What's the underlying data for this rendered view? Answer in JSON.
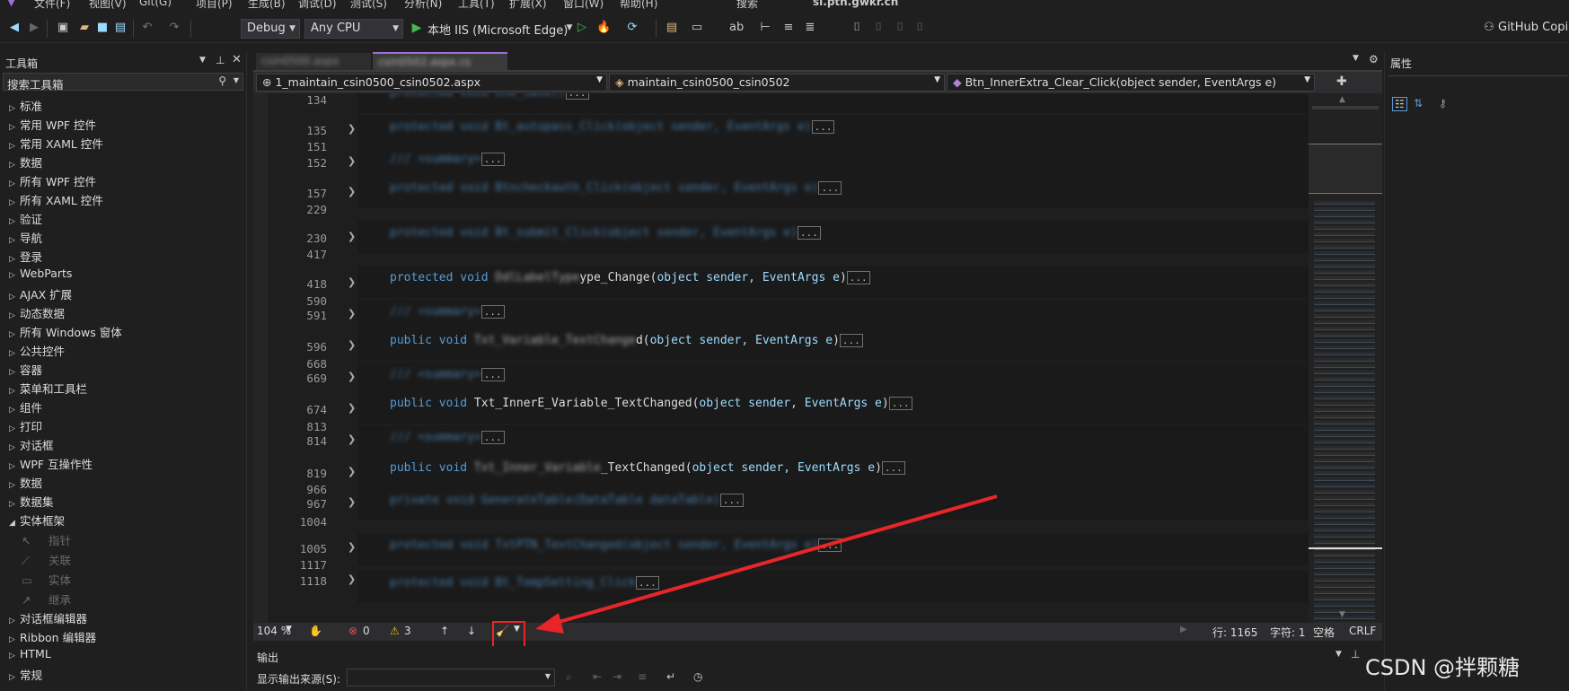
{
  "menu": [
    "文件(F)",
    "视图(V)",
    "Git(G)",
    "项目(P)",
    "生成(B)",
    "调试(D)",
    "测试(S)",
    "分析(N)",
    "工具(T)",
    "扩展(X)",
    "窗口(W)",
    "帮助(H)",
    "搜索",
    "sl.ptn.gwkr.cn"
  ],
  "toolbar": {
    "config": "Debug",
    "platform": "Any CPU",
    "run_target": "本地 IIS (Microsoft Edge)",
    "copilot": "GitHub Copilot"
  },
  "toolbox": {
    "title": "工具箱",
    "search_placeholder": "搜索工具箱",
    "items": [
      "标准",
      "常用 WPF 控件",
      "常用 XAML 控件",
      "数据",
      "所有 WPF 控件",
      "所有 XAML 控件",
      "验证",
      "导航",
      "登录",
      "WebParts",
      "AJAX 扩展",
      "动态数据",
      "所有 Windows 窗体",
      "公共控件",
      "容器",
      "菜单和工具栏",
      "组件",
      "打印",
      "对话框",
      "WPF 互操作性",
      "数据",
      "数据集",
      "实体框架"
    ],
    "sub_items": [
      "指针",
      "关联",
      "实体",
      "继承"
    ],
    "items_after": [
      "对话框编辑器",
      "Ribbon 编辑器",
      "HTML",
      "常规"
    ]
  },
  "editor": {
    "tabs": [
      "csin0500.aspx",
      "csin0502.aspx.cs"
    ],
    "nav": {
      "file": "1_maintain_csin0500_csin0502.aspx",
      "class": "maintain_csin0500_csin0502",
      "member": "Btn_InnerExtra_Clear_Click(object sender, EventArgs e)"
    },
    "lines": [
      {
        "num": "134",
        "text": "protected void Lnk_Save()"
      },
      {
        "num": "135",
        "text": "protected void Bt_autopass_Click(object sender, EventArgs e)"
      },
      {
        "num": "151",
        "text": ""
      },
      {
        "num": "152",
        "text": "/// <summary>"
      },
      {
        "num": "157",
        "text": "protected void Btncheckauth_Click(object sender, EventArgs e)"
      },
      {
        "num": "229",
        "text": ""
      },
      {
        "num": "230",
        "text": "protected void Bt_submit_Click(object sender, EventArgs e)"
      },
      {
        "num": "417",
        "text": ""
      },
      {
        "num": "418",
        "kw": "protected void ",
        "name_blur": "DdlLabelType",
        "name": "ype_Change",
        "params": "object sender, EventArgs e"
      },
      {
        "num": "590",
        "text": ""
      },
      {
        "num": "591",
        "text": "/// <summary>"
      },
      {
        "num": "596",
        "kw": "public void ",
        "name_blur": "Txt_Variable_TextChange",
        "name": "d",
        "params": "object sender, EventArgs e"
      },
      {
        "num": "668",
        "text": ""
      },
      {
        "num": "669",
        "text": "/// <summary>"
      },
      {
        "num": "674",
        "kw": "public void ",
        "name_blur": "",
        "name": "Txt_InnerE_Variable_TextChanged",
        "params": "object sender, EventArgs e"
      },
      {
        "num": "813",
        "text": ""
      },
      {
        "num": "814",
        "text": "/// <summary>"
      },
      {
        "num": "819",
        "kw": "public void ",
        "name_blur": "Txt_Inner_Variable",
        "name": "_TextChanged",
        "params": "object sender, EventArgs e"
      },
      {
        "num": "966",
        "text": ""
      },
      {
        "num": "967",
        "text": "private void GenerateTable(DataTable dataTable)"
      },
      {
        "num": "1004",
        "text": ""
      },
      {
        "num": "1005",
        "text": "protected void TxtPTN_TextChanged(object sender, EventArgs e)"
      },
      {
        "num": "1117",
        "text": ""
      },
      {
        "num": "1118",
        "text": "protected void Bt_TempSetting_Click"
      }
    ]
  },
  "status": {
    "zoom": "104 %",
    "errors": "0",
    "warnings": "3",
    "line": "行: 1165",
    "char": "字符: 1",
    "ws": "空格",
    "eol": "CRLF"
  },
  "output": {
    "title": "输出",
    "source_label": "显示输出来源(S):"
  },
  "properties": {
    "title": "属性"
  },
  "watermark": "CSDN @拌颗糖",
  "colors": {
    "annotation": "#e8262a",
    "keyword": "#569cd6",
    "type": "#4ec9b0"
  }
}
